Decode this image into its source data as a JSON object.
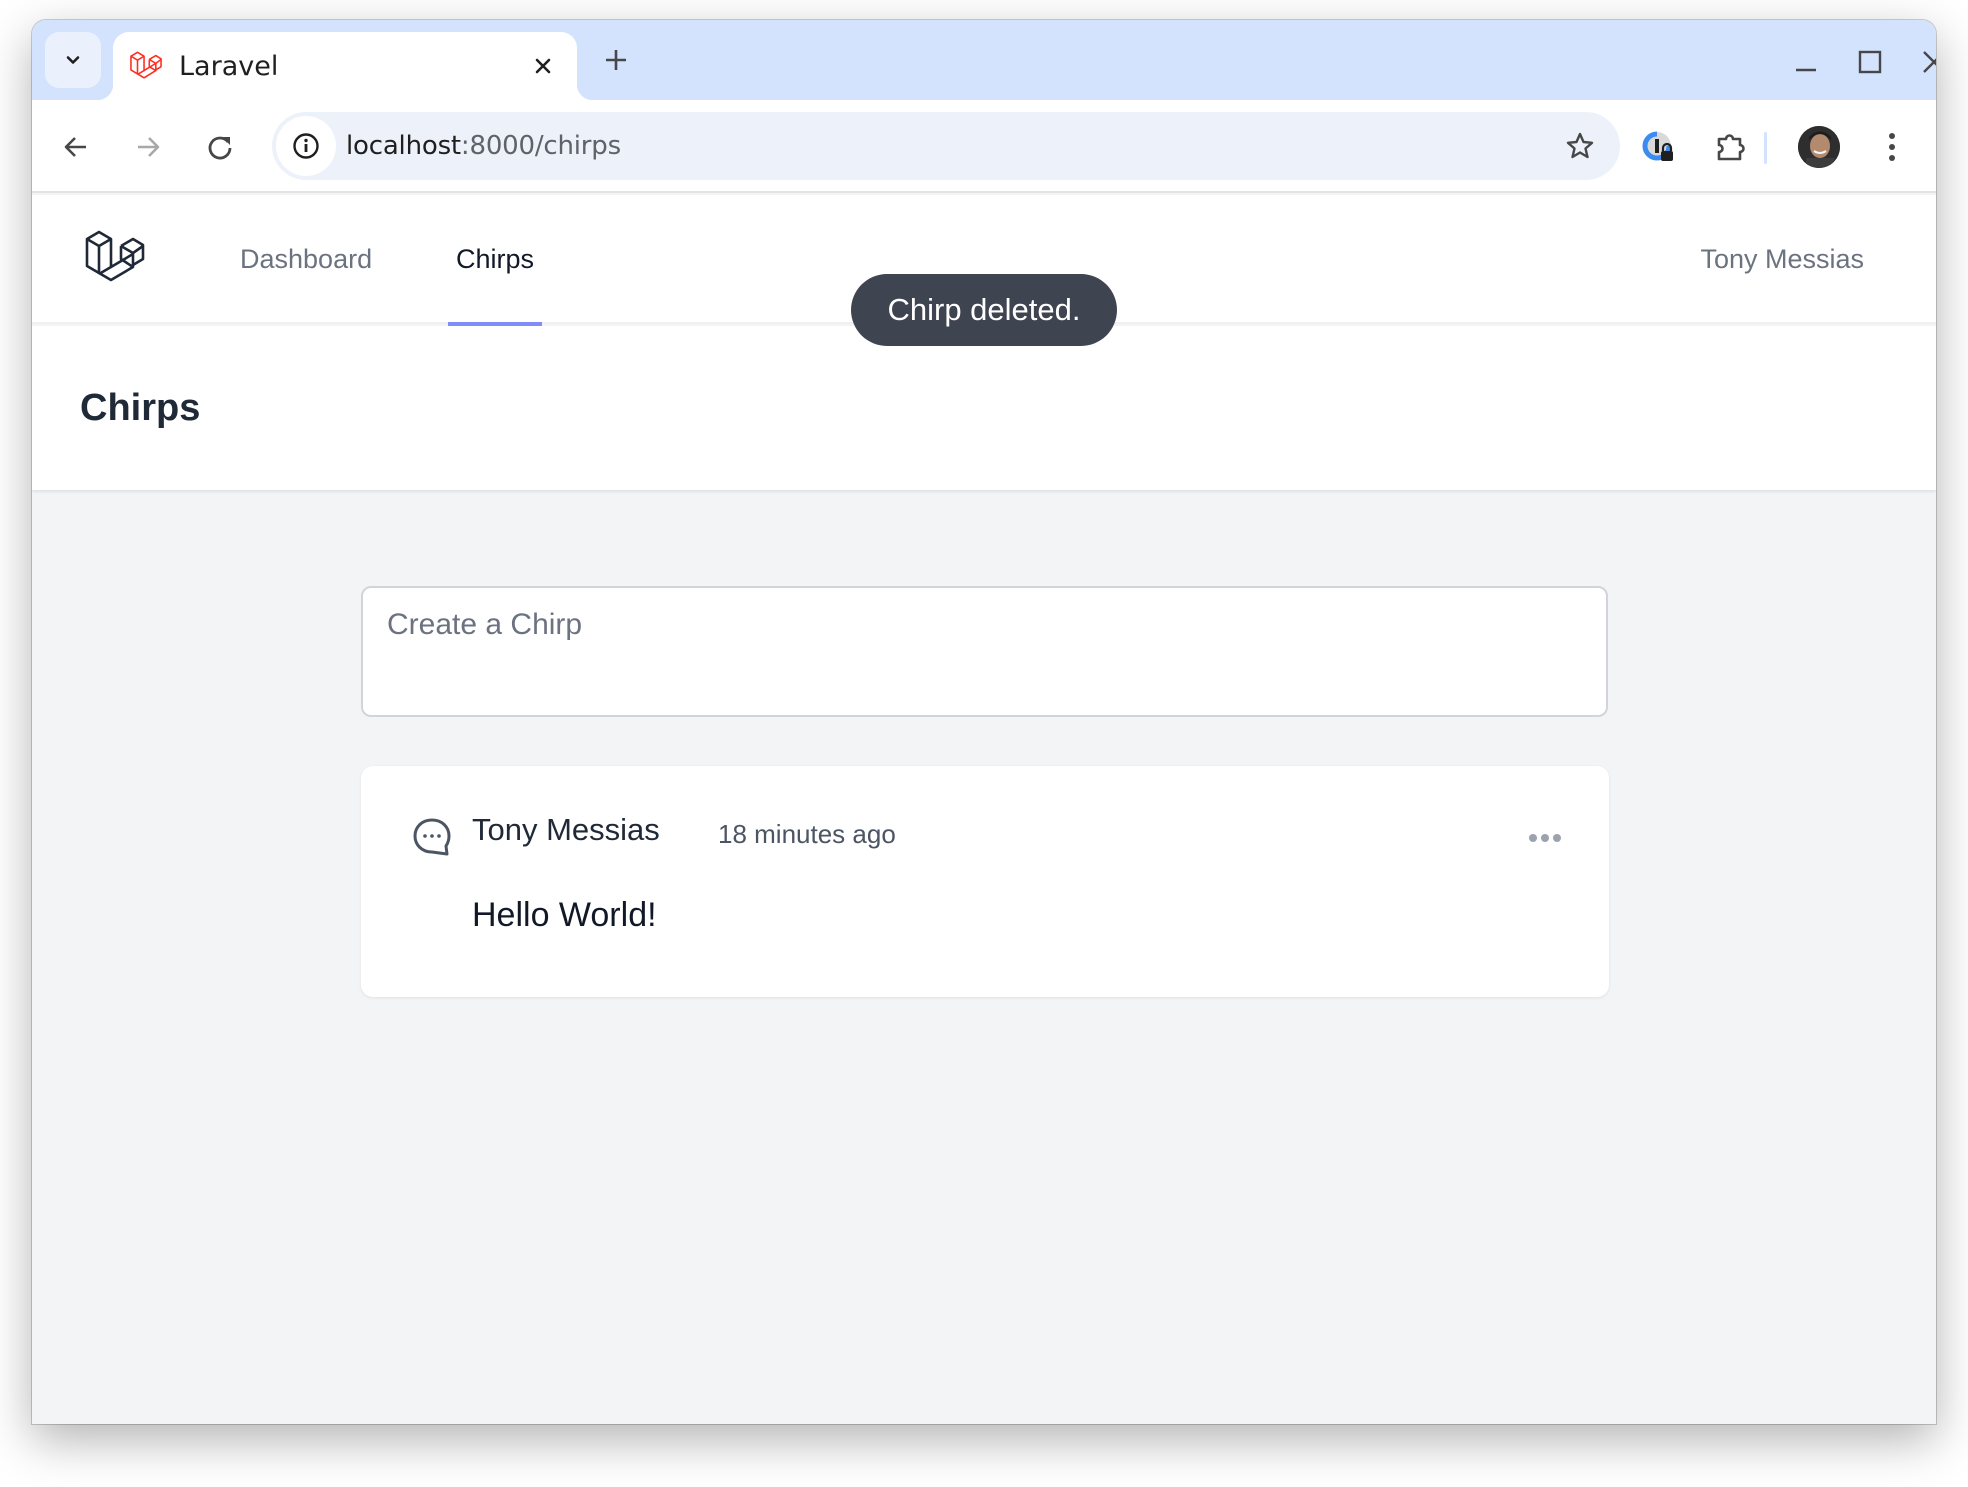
{
  "browser": {
    "tab": {
      "title": "Laravel"
    },
    "url": {
      "host": "localhost",
      "path": ":8000/chirps"
    }
  },
  "nav": {
    "links": [
      {
        "label": "Dashboard",
        "active": false
      },
      {
        "label": "Chirps",
        "active": true
      }
    ],
    "user_name": "Tony Messias"
  },
  "header": {
    "title": "Chirps"
  },
  "toast": {
    "message": "Chirp deleted."
  },
  "composer": {
    "placeholder": "Create a Chirp",
    "value": ""
  },
  "chirps": [
    {
      "author": "Tony Messias",
      "time": "18 minutes ago",
      "message": "Hello World!"
    }
  ],
  "colors": {
    "accent": "#818cf8",
    "toast_bg": "#3f4451",
    "tabstrip_bg": "#d3e3fd",
    "laravel_red": "#ff2d20"
  }
}
